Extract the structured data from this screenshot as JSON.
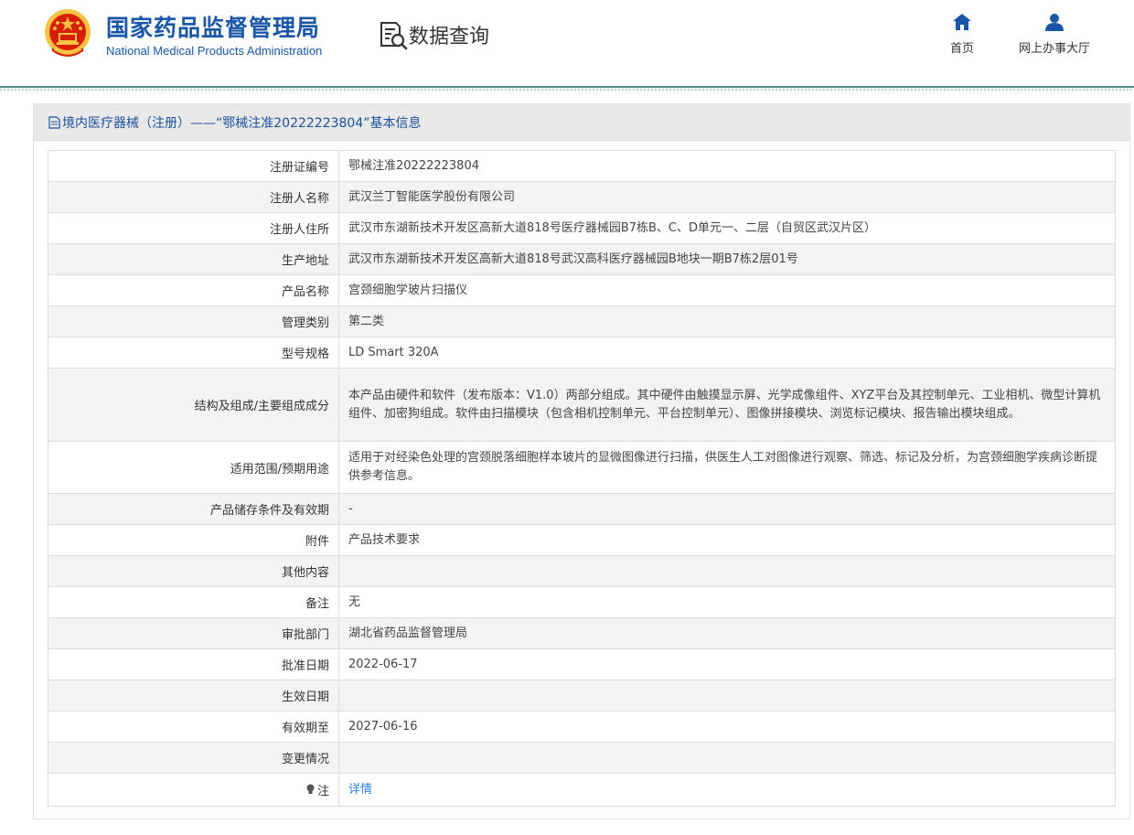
{
  "header": {
    "agency_cn": "国家药品监督管理局",
    "agency_en": "National Medical Products Administration",
    "section_title": "数据查询",
    "nav": [
      {
        "label": "首页",
        "icon": "home-icon"
      },
      {
        "label": "网上办事大厅",
        "icon": "user-icon"
      }
    ]
  },
  "panel": {
    "title": "境内医疗器械（注册）——“鄂械注准20222223804”基本信息"
  },
  "rows": [
    {
      "key": "注册证编号",
      "value": "鄂械注准20222223804"
    },
    {
      "key": "注册人名称",
      "value": "武汉兰丁智能医学股份有限公司"
    },
    {
      "key": "注册人住所",
      "value": "武汉市东湖新技术开发区高新大道818号医疗器械园B7栋B、C、D单元一、二层（自贸区武汉片区）"
    },
    {
      "key": "生产地址",
      "value": "武汉市东湖新技术开发区高新大道818号武汉高科医疗器械园B地块一期B7栋2层01号"
    },
    {
      "key": "产品名称",
      "value": "宫颈细胞学玻片扫描仪"
    },
    {
      "key": "管理类别",
      "value": "第二类"
    },
    {
      "key": "型号规格",
      "value": "LD Smart 320A"
    },
    {
      "key": "结构及组成/主要组成成分",
      "value": "本产品由硬件和软件（发布版本：V1.0）两部分组成。其中硬件由触摸显示屏、光学成像组件、XYZ平台及其控制单元、工业相机、微型计算机组件、加密狗组成。软件由扫描模块（包含相机控制单元、平台控制单元）、图像拼接模块、浏览标记模块、报告输出模块组成。"
    },
    {
      "key": "适用范围/预期用途",
      "value": "适用于对经染色处理的宫颈脱落细胞样本玻片的显微图像进行扫描，供医生人工对图像进行观察、筛选、标记及分析，为宫颈细胞学疾病诊断提供参考信息。"
    },
    {
      "key": "产品储存条件及有效期",
      "value": "-"
    },
    {
      "key": "附件",
      "value": "产品技术要求"
    },
    {
      "key": "其他内容",
      "value": ""
    },
    {
      "key": "备注",
      "value": "无"
    },
    {
      "key": "审批部门",
      "value": "湖北省药品监督管理局"
    },
    {
      "key": "批准日期",
      "value": "2022-06-17"
    },
    {
      "key": "生效日期",
      "value": ""
    },
    {
      "key": "有效期至",
      "value": "2027-06-16"
    },
    {
      "key": "变更情况",
      "value": ""
    },
    {
      "key": "注",
      "value": "详情",
      "is_link": true
    }
  ],
  "colors": {
    "brand_blue": "#1a56a8",
    "link_blue": "#2a7fd4",
    "emblem_red": "#d81e06",
    "emblem_gold": "#f6c343"
  }
}
